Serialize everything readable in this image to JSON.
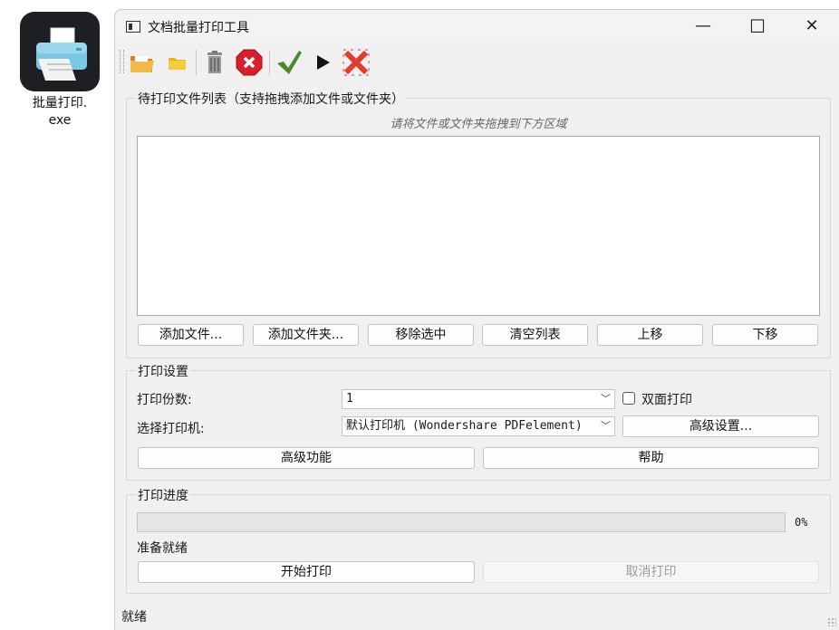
{
  "desktop": {
    "icon_label_line1": "批量打印.",
    "icon_label_line2": "exe",
    "icon": "printer-icon"
  },
  "window": {
    "title": "文档批量打印工具",
    "controls": {
      "minimize": "—",
      "maximize": "☐",
      "close": "✕"
    }
  },
  "toolbar": {
    "items": [
      "open-folder-icon",
      "folder-icon",
      "trash-icon",
      "remove-icon",
      "check-icon",
      "play-icon",
      "clear-all-icon"
    ]
  },
  "files": {
    "group_title": "待打印文件列表（支持拖拽添加文件或文件夹）",
    "hint": "请将文件或文件夹拖拽到下方区域",
    "buttons": {
      "add_file": "添加文件...",
      "add_folder": "添加文件夹...",
      "remove": "移除选中",
      "clear": "清空列表",
      "up": "上移",
      "down": "下移"
    }
  },
  "settings": {
    "group_title": "打印设置",
    "copies_label": "打印份数:",
    "copies_value": "1",
    "duplex_label": "双面打印",
    "duplex_checked": false,
    "printer_label": "选择打印机:",
    "printer_value": "默认打印机 (Wondershare PDFelement)",
    "advanced_settings": "高级设置...",
    "advanced_features": "高级功能",
    "help": "帮助"
  },
  "progress": {
    "group_title": "打印进度",
    "percent_text": "0%",
    "percent": 0,
    "status": "准备就绪",
    "start": "开始打印",
    "cancel": "取消打印"
  },
  "statusbar": {
    "text": "就绪"
  }
}
